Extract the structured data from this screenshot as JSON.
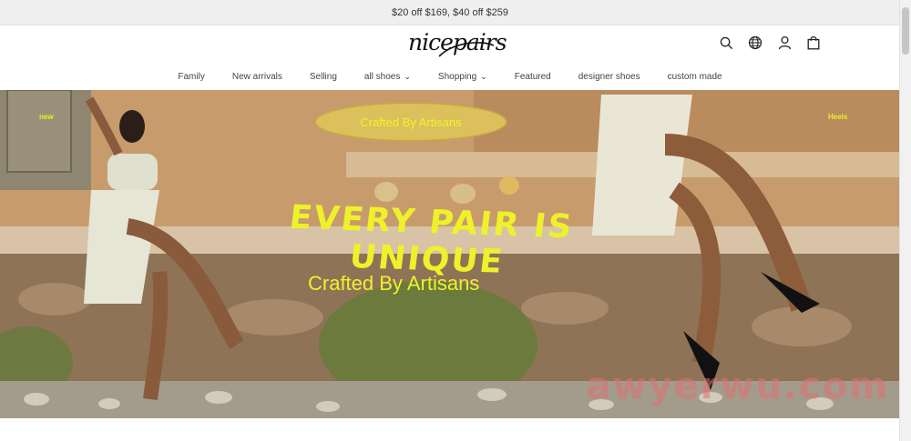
{
  "promo": {
    "text": "$20 off $169, $40 off $259"
  },
  "brand": {
    "logo_text": "nicepairs"
  },
  "header_icons": [
    "search-icon",
    "globe-icon",
    "user-icon",
    "bag-icon"
  ],
  "nav": [
    {
      "label": "Family"
    },
    {
      "label": "New arrivals"
    },
    {
      "label": "Selling"
    },
    {
      "label": "all shoes",
      "dropdown": true
    },
    {
      "label": "Shopping",
      "dropdown": true
    },
    {
      "label": "Featured"
    },
    {
      "label": "designer shoes"
    },
    {
      "label": "custom made"
    }
  ],
  "hero": {
    "pill_text": "Crafted By Artisans",
    "corner_left": "new",
    "corner_right": "Heels",
    "headline": "EVERY PAIR IS UNIQUE",
    "subline": "Crafted By Artisans"
  },
  "watermark": "awyerwu.com",
  "colors": {
    "accent_yellow": "#eef22a",
    "promo_bg": "#efefef"
  }
}
